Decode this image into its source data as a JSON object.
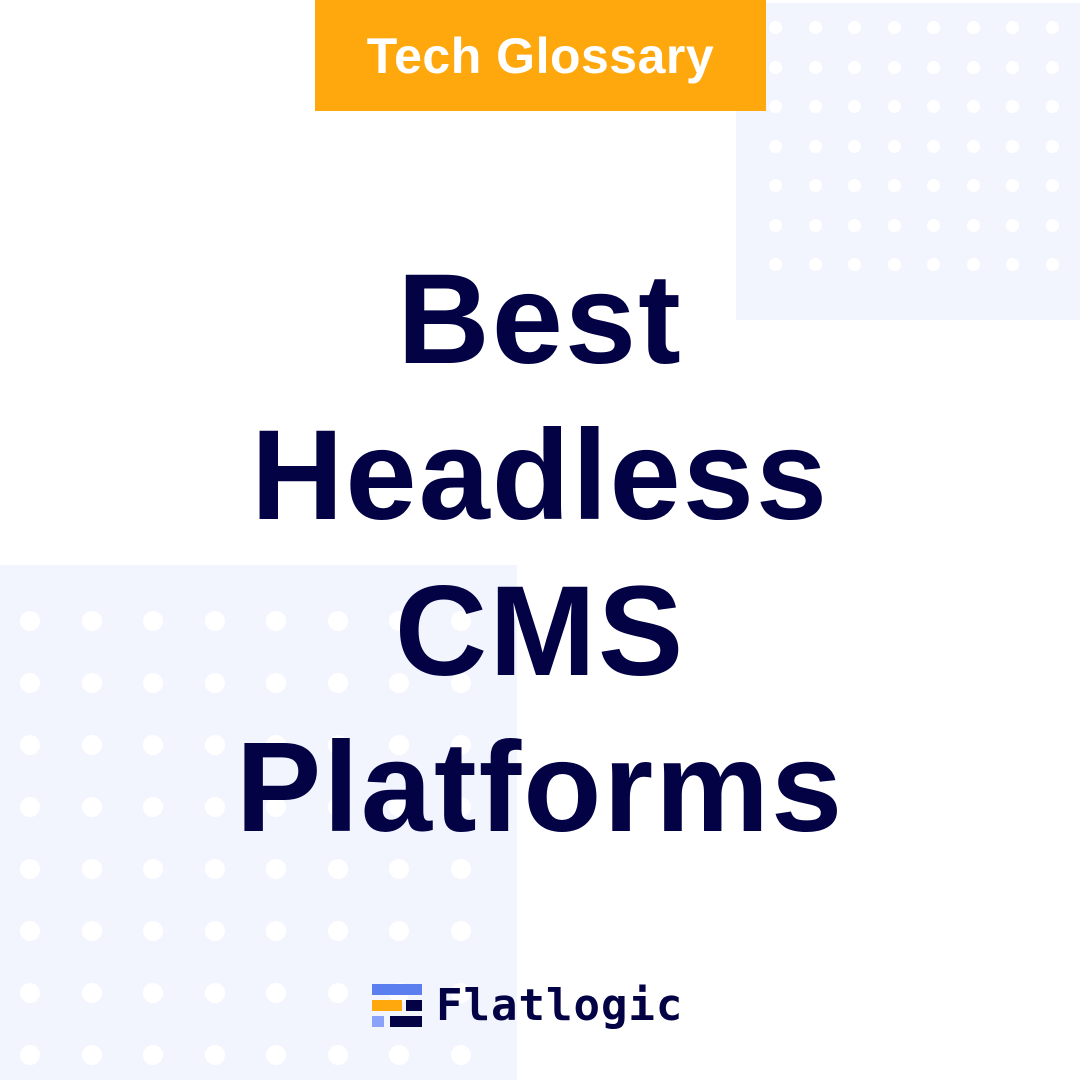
{
  "badge": {
    "label": "Tech Glossary",
    "color": "#fea80e"
  },
  "title": {
    "lines": [
      "Best",
      "Headless",
      "CMS",
      "Platforms"
    ],
    "color": "#020244"
  },
  "logo": {
    "name": "Flatlogic",
    "icon": "flatlogic-logo-icon",
    "colors": {
      "blue": "#5b7fef",
      "orange": "#fea80e",
      "light_blue": "#8aa2f7",
      "navy": "#020244"
    }
  },
  "background": {
    "panel_color": "#f2f5fd",
    "dot_color": "#ffffff"
  }
}
